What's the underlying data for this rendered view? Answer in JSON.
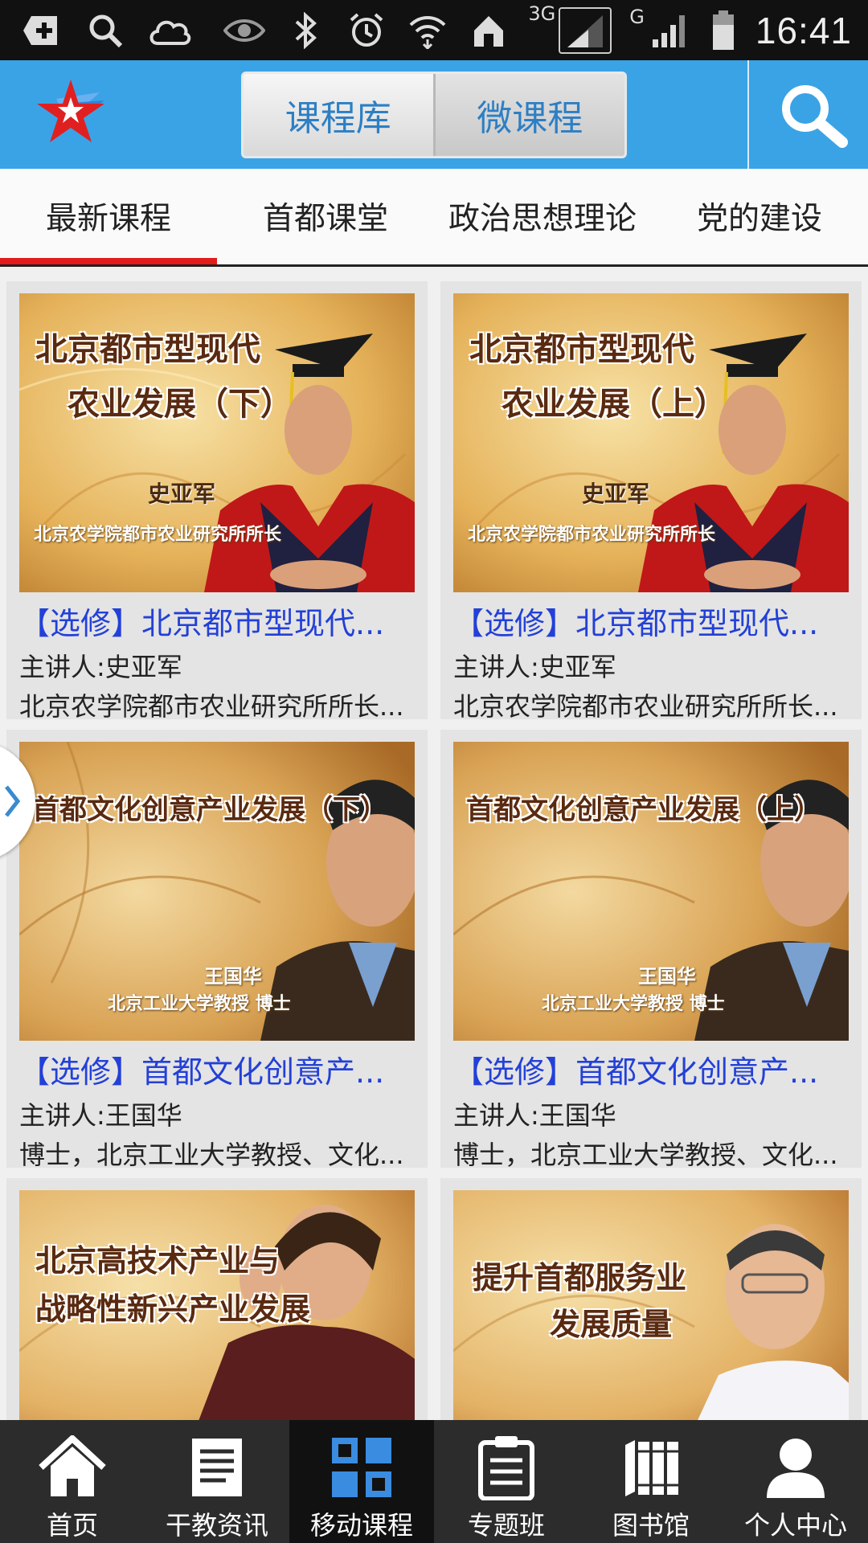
{
  "status_bar": {
    "network": "3G",
    "network2": "G",
    "time": "16:41"
  },
  "header": {
    "segments": [
      "课程库",
      "微课程"
    ],
    "active_segment": 0
  },
  "tabs": {
    "items": [
      "最新课程",
      "首都课堂",
      "政治思想理论",
      "党的建设"
    ],
    "active": 0
  },
  "courses": [
    {
      "thumb_title_lines": [
        "北京都市型现代",
        "农业发展（下）"
      ],
      "thumb_name": "史亚军",
      "thumb_subtitle": "北京农学院都市农业研究所所长",
      "title": "【选修】北京都市型现代...",
      "lecturer": "主讲人:史亚军",
      "description": "北京农学院都市农业研究所所长..."
    },
    {
      "thumb_title_lines": [
        "北京都市型现代",
        "农业发展（上）"
      ],
      "thumb_name": "史亚军",
      "thumb_subtitle": "北京农学院都市农业研究所所长",
      "title": "【选修】北京都市型现代...",
      "lecturer": "主讲人:史亚军",
      "description": "北京农学院都市农业研究所所长..."
    },
    {
      "thumb_title_lines": [
        "首都文化创意产业发展（下）"
      ],
      "thumb_name": "王国华",
      "thumb_subtitle": "北京工业大学教授 博士",
      "title": "【选修】首都文化创意产...",
      "lecturer": "主讲人:王国华",
      "description": "博士，北京工业大学教授、文化..."
    },
    {
      "thumb_title_lines": [
        "首都文化创意产业发展（上）"
      ],
      "thumb_name": "王国华",
      "thumb_subtitle": "北京工业大学教授 博士",
      "title": "【选修】首都文化创意产...",
      "lecturer": "主讲人:王国华",
      "description": "博士，北京工业大学教授、文化..."
    },
    {
      "thumb_title_lines": [
        "北京高技术产业与",
        "战略性新兴产业发展"
      ],
      "thumb_name": "",
      "thumb_subtitle": "",
      "title": "",
      "lecturer": "",
      "description": ""
    },
    {
      "thumb_title_lines": [
        "提升首都服务业",
        "发展质量"
      ],
      "thumb_name": "",
      "thumb_subtitle": "",
      "title": "",
      "lecturer": "",
      "description": ""
    }
  ],
  "bottom_nav": {
    "items": [
      "首页",
      "干教资讯",
      "移动课程",
      "专题班",
      "图书馆",
      "个人中心"
    ],
    "icons": [
      "home-icon",
      "news-icon",
      "grid-icon",
      "clipboard-icon",
      "books-icon",
      "person-icon"
    ],
    "active": 2
  },
  "colors": {
    "header_blue": "#3aa3e6",
    "tab_indicator_red": "#e31b1b",
    "link_blue": "#2340d8"
  }
}
